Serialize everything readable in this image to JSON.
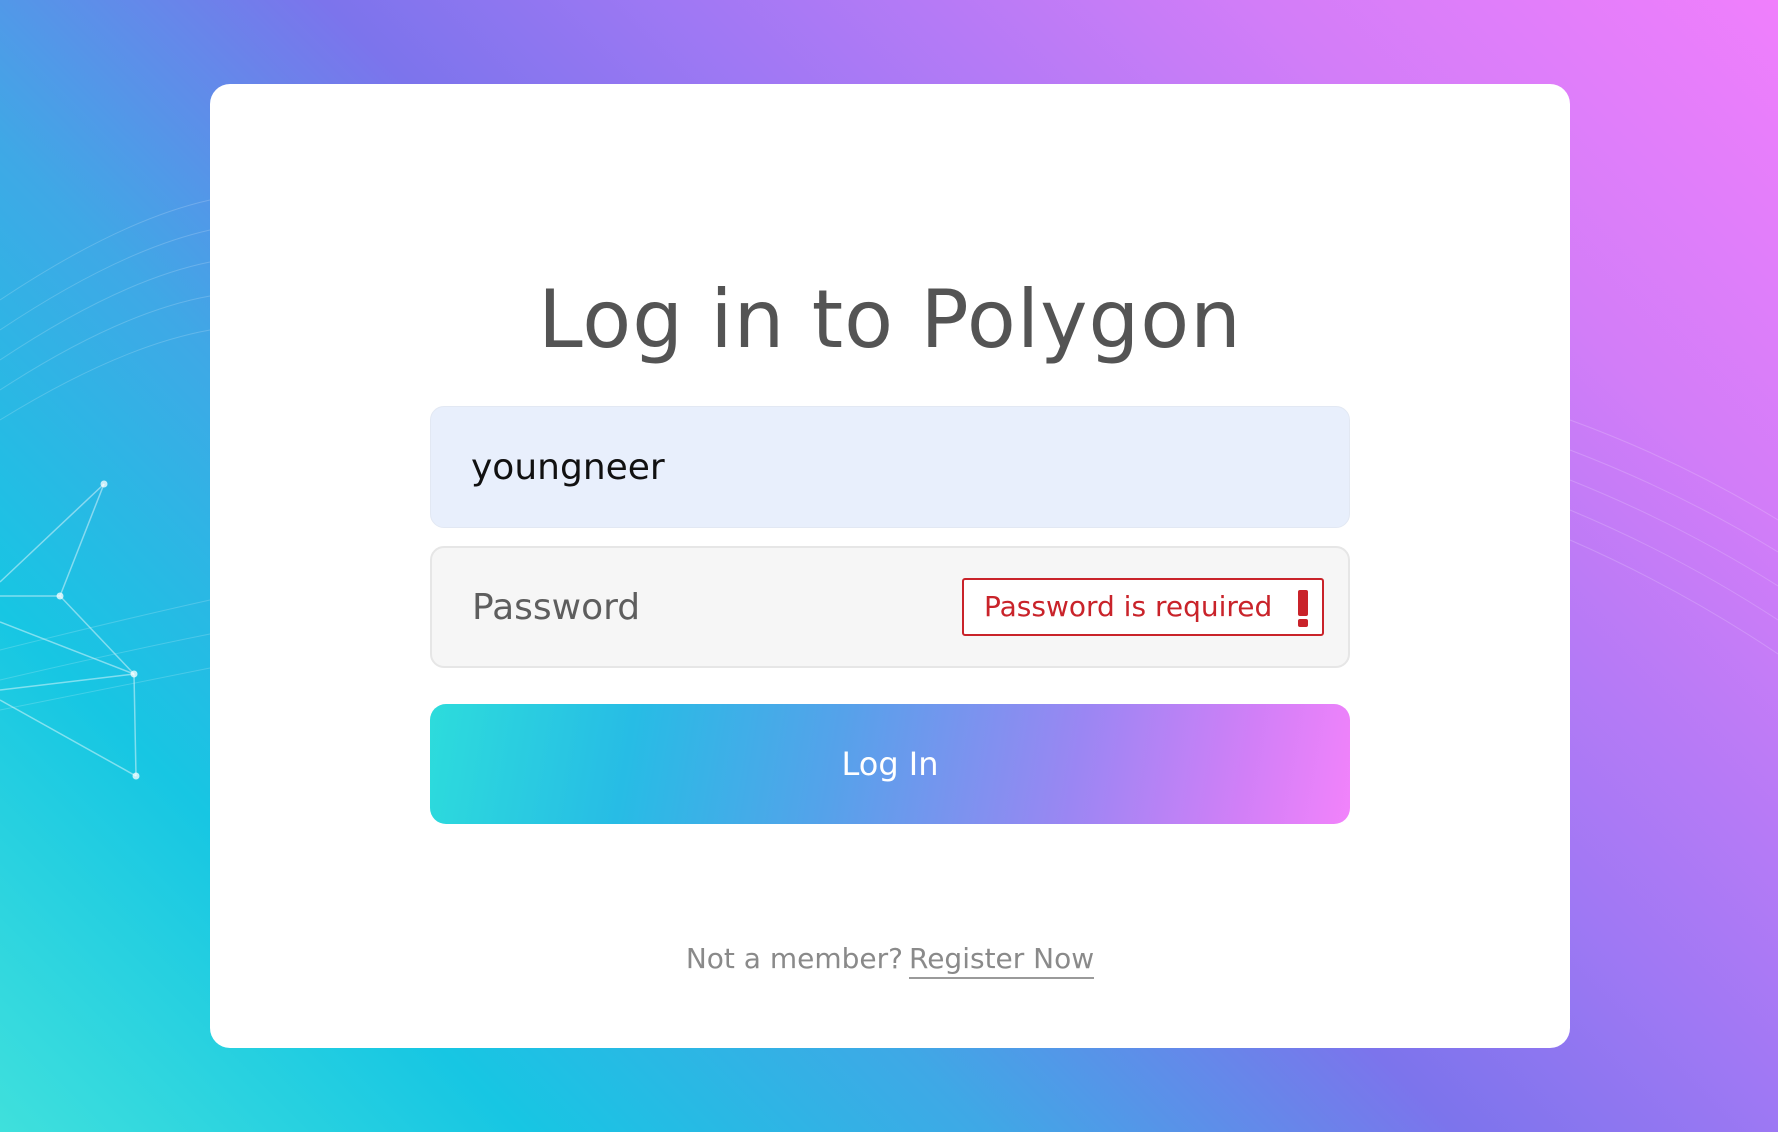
{
  "login_card": {
    "title": "Log in to Polygon",
    "username": {
      "value": "youngneer"
    },
    "password": {
      "placeholder": "Password",
      "error_message": "Password is required"
    },
    "login_button_label": "Log In",
    "register_prompt": "Not a member?",
    "register_link_label": "Register Now"
  },
  "colors": {
    "error": "#c9232a",
    "title_text": "#545454",
    "username_field_bg": "#e8effc",
    "password_field_bg": "#f6f6f6",
    "gradient_cyan": "#2ddcdc",
    "gradient_violet": "#7c74ec",
    "gradient_pink": "#f283fb"
  },
  "icons": {
    "error": "exclamation-icon"
  }
}
